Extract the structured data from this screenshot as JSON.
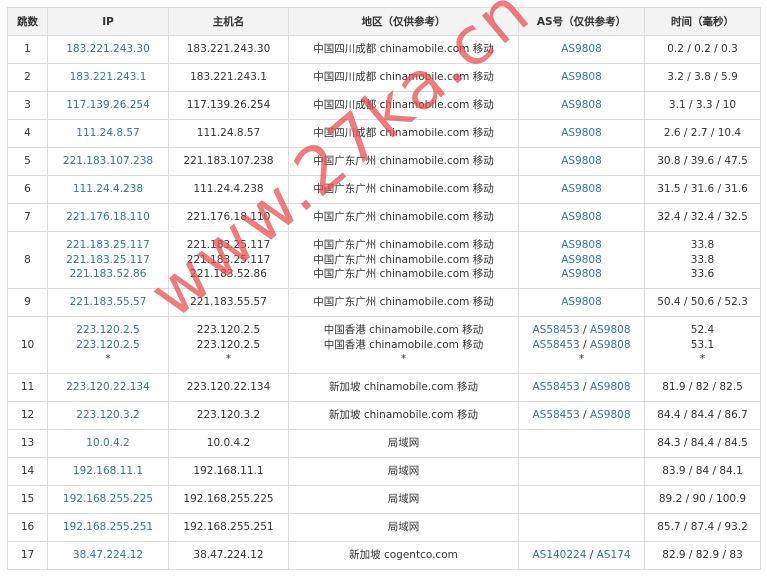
{
  "headers": {
    "hop": "跳数",
    "ip": "IP",
    "host": "主机名",
    "region": "地区（仅供参考）",
    "as": "AS号（仅供参考）",
    "time": "时间（毫秒）"
  },
  "rows": [
    {
      "hop": "1",
      "ips": [
        "183.221.243.30"
      ],
      "hosts": [
        "183.221.243.30"
      ],
      "regions": [
        "中国四川成都 chinamobile.com 移动"
      ],
      "as": [
        [
          "AS9808"
        ]
      ],
      "times": [
        "0.2 / 0.2 / 0.3"
      ]
    },
    {
      "hop": "2",
      "ips": [
        "183.221.243.1"
      ],
      "hosts": [
        "183.221.243.1"
      ],
      "regions": [
        "中国四川成都 chinamobile.com 移动"
      ],
      "as": [
        [
          "AS9808"
        ]
      ],
      "times": [
        "3.2 / 3.8 / 5.9"
      ]
    },
    {
      "hop": "3",
      "ips": [
        "117.139.26.254"
      ],
      "hosts": [
        "117.139.26.254"
      ],
      "regions": [
        "中国四川成都 chinamobile.com 移动"
      ],
      "as": [
        [
          "AS9808"
        ]
      ],
      "times": [
        "3.1 / 3.3 / 10"
      ]
    },
    {
      "hop": "4",
      "ips": [
        "111.24.8.57"
      ],
      "hosts": [
        "111.24.8.57"
      ],
      "regions": [
        "中国四川成都 chinamobile.com 移动"
      ],
      "as": [
        [
          "AS9808"
        ]
      ],
      "times": [
        "2.6 / 2.7 / 10.4"
      ]
    },
    {
      "hop": "5",
      "ips": [
        "221.183.107.238"
      ],
      "hosts": [
        "221.183.107.238"
      ],
      "regions": [
        "中国广东广州 chinamobile.com 移动"
      ],
      "as": [
        [
          "AS9808"
        ]
      ],
      "times": [
        "30.8 / 39.6 / 47.5"
      ]
    },
    {
      "hop": "6",
      "ips": [
        "111.24.4.238"
      ],
      "hosts": [
        "111.24.4.238"
      ],
      "regions": [
        "中国广东广州 chinamobile.com 移动"
      ],
      "as": [
        [
          "AS9808"
        ]
      ],
      "times": [
        "31.5 / 31.6 / 31.6"
      ]
    },
    {
      "hop": "7",
      "ips": [
        "221.176.18.110"
      ],
      "hosts": [
        "221.176.18.110"
      ],
      "regions": [
        "中国广东广州 chinamobile.com 移动"
      ],
      "as": [
        [
          "AS9808"
        ]
      ],
      "times": [
        "32.4 / 32.4 / 32.5"
      ]
    },
    {
      "hop": "8",
      "ips": [
        "221.183.25.117",
        "221.183.25.117",
        "221.183.52.86"
      ],
      "hosts": [
        "221.183.25.117",
        "221.183.25.117",
        "221.183.52.86"
      ],
      "regions": [
        "中国广东广州 chinamobile.com 移动",
        "中国广东广州 chinamobile.com 移动",
        "中国广东广州 chinamobile.com 移动"
      ],
      "as": [
        [
          "AS9808"
        ],
        [
          "AS9808"
        ],
        [
          "AS9808"
        ]
      ],
      "times": [
        "33.8",
        "33.8",
        "33.6"
      ]
    },
    {
      "hop": "9",
      "ips": [
        "221.183.55.57"
      ],
      "hosts": [
        "221.183.55.57"
      ],
      "regions": [
        "中国广东广州 chinamobile.com 移动"
      ],
      "as": [
        [
          "AS9808"
        ]
      ],
      "times": [
        "50.4 / 50.6 / 52.3"
      ]
    },
    {
      "hop": "10",
      "ips": [
        "223.120.2.5",
        "223.120.2.5",
        "*"
      ],
      "hosts": [
        "223.120.2.5",
        "223.120.2.5",
        "*"
      ],
      "regions": [
        "中国香港 chinamobile.com 移动",
        "中国香港 chinamobile.com 移动",
        "*"
      ],
      "as": [
        [
          "AS58453",
          "AS9808"
        ],
        [
          "AS58453",
          "AS9808"
        ],
        [
          "*"
        ]
      ],
      "times": [
        "52.4",
        "53.1",
        "*"
      ]
    },
    {
      "hop": "11",
      "ips": [
        "223.120.22.134"
      ],
      "hosts": [
        "223.120.22.134"
      ],
      "regions": [
        "新加坡 chinamobile.com 移动"
      ],
      "as": [
        [
          "AS58453",
          "AS9808"
        ]
      ],
      "times": [
        "81.9 / 82 / 82.5"
      ]
    },
    {
      "hop": "12",
      "ips": [
        "223.120.3.2"
      ],
      "hosts": [
        "223.120.3.2"
      ],
      "regions": [
        "新加坡 chinamobile.com 移动"
      ],
      "as": [
        [
          "AS58453",
          "AS9808"
        ]
      ],
      "times": [
        "84.4 / 84.4 / 86.7"
      ]
    },
    {
      "hop": "13",
      "ips": [
        "10.0.4.2"
      ],
      "hosts": [
        "10.0.4.2"
      ],
      "regions": [
        "局域网"
      ],
      "as": [
        []
      ],
      "times": [
        "84.3 / 84.4 / 84.5"
      ]
    },
    {
      "hop": "14",
      "ips": [
        "192.168.11.1"
      ],
      "hosts": [
        "192.168.11.1"
      ],
      "regions": [
        "局域网"
      ],
      "as": [
        []
      ],
      "times": [
        "83.9 / 84 / 84.1"
      ]
    },
    {
      "hop": "15",
      "ips": [
        "192.168.255.225"
      ],
      "hosts": [
        "192.168.255.225"
      ],
      "regions": [
        "局域网"
      ],
      "as": [
        []
      ],
      "times": [
        "89.2 / 90 / 100.9"
      ]
    },
    {
      "hop": "16",
      "ips": [
        "192.168.255.251"
      ],
      "hosts": [
        "192.168.255.251"
      ],
      "regions": [
        "局域网"
      ],
      "as": [
        []
      ],
      "times": [
        "85.7 / 87.4 / 93.2"
      ]
    },
    {
      "hop": "17",
      "ips": [
        "38.47.224.12"
      ],
      "hosts": [
        "38.47.224.12"
      ],
      "regions": [
        "新加坡 cogentco.com"
      ],
      "as": [
        [
          "AS140224",
          "AS174"
        ]
      ],
      "times": [
        "82.9 / 82.9 / 83"
      ]
    }
  ],
  "watermark": "www.27ka.cn",
  "colors": {
    "link": "#3173b7",
    "header_bg": "#f3f3f3",
    "border": "#dcdcdc",
    "watermark": "#e84a4a"
  }
}
